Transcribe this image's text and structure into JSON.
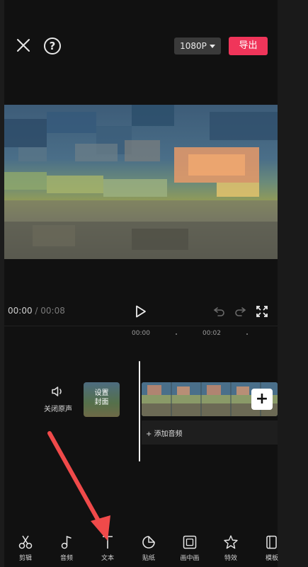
{
  "header": {
    "resolution_label": "1080P",
    "export_label": "导出"
  },
  "playback": {
    "current_time": "00:00",
    "separator": " / ",
    "total_time": "00:08"
  },
  "ruler": {
    "ticks": [
      "00:00",
      "00:02"
    ]
  },
  "timeline": {
    "mute_label": "关闭原声",
    "cover_label_line1": "设置",
    "cover_label_line2": "封面",
    "add_audio_label": "+ 添加音频"
  },
  "toolbar": {
    "items": [
      {
        "label": "剪辑",
        "icon": "scissors-icon"
      },
      {
        "label": "音频",
        "icon": "music-note-icon"
      },
      {
        "label": "文本",
        "icon": "text-icon"
      },
      {
        "label": "贴纸",
        "icon": "sticker-icon"
      },
      {
        "label": "画中画",
        "icon": "picture-in-picture-icon"
      },
      {
        "label": "特效",
        "icon": "effects-star-icon"
      },
      {
        "label": "模板",
        "icon": "template-icon"
      }
    ]
  },
  "colors": {
    "background": "#111111",
    "export_button": "#f0355a",
    "annotation_arrow": "#f04a4a"
  }
}
